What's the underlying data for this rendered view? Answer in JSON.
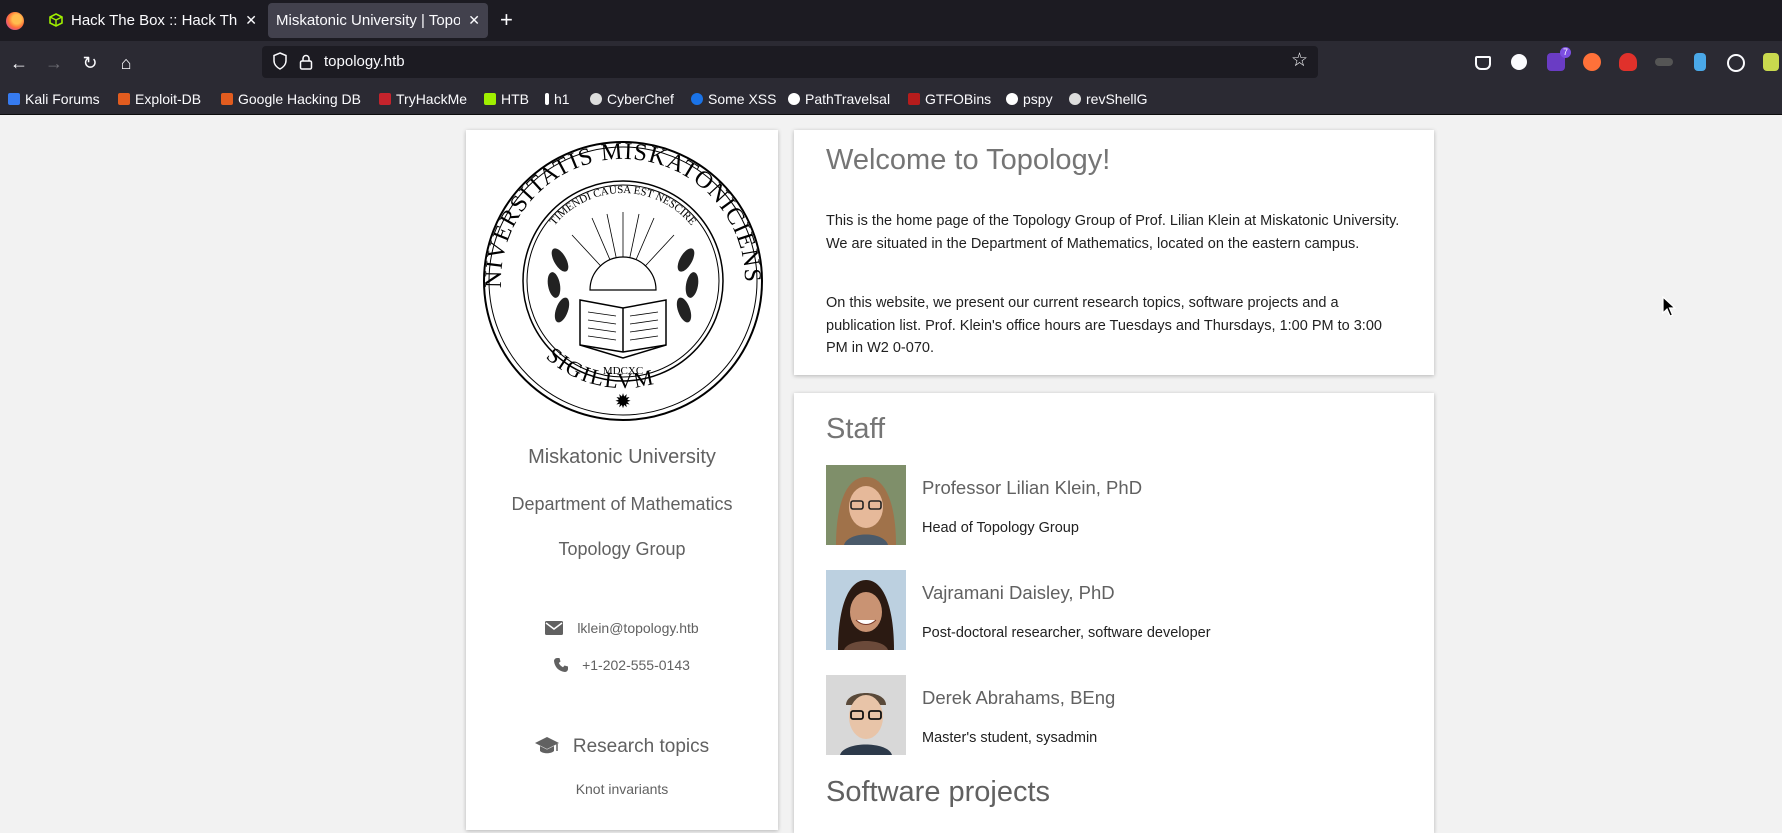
{
  "browser": {
    "tabs": [
      {
        "title": "Hack The Box :: Hack The Box",
        "active": false
      },
      {
        "title": "Miskatonic University | Topology Group",
        "active": true
      }
    ],
    "url": "topology.htb",
    "bookmarks": [
      {
        "label": "Kali Forums",
        "color": "#367bf0"
      },
      {
        "label": "Exploit-DB",
        "color": "#e25c1f"
      },
      {
        "label": "Google Hacking DB",
        "color": "#e25c1f"
      },
      {
        "label": "TryHackMe",
        "color": "#c5232c"
      },
      {
        "label": "HTB",
        "color": "#9fef00"
      },
      {
        "label": "h1",
        "color": "#ffffff"
      },
      {
        "label": "CyberChef",
        "color": "#dddddd"
      },
      {
        "label": "Some XSS",
        "color": "#1a73e8"
      },
      {
        "label": "PathTravelsal",
        "color": "#ffffff"
      },
      {
        "label": "GTFOBins",
        "color": "#b71c1c"
      },
      {
        "label": "pspy",
        "color": "#ffffff"
      },
      {
        "label": "revShellG",
        "color": "#dddddd"
      }
    ],
    "extension_badge": "7"
  },
  "sidebar": {
    "seal_text": {
      "outer_top": "UNIVERSITATIS MISKATONICIENSIS",
      "outer_bottom": "SIGILLVM",
      "motto": "TIMENDI CAUSA EST NESCIRE",
      "year": "MDCXC"
    },
    "university": "Miskatonic University",
    "department": "Department of Mathematics",
    "group": "Topology Group",
    "email": "lklein@topology.htb",
    "phone": "+1-202-555-0143",
    "research_heading": "Research topics",
    "research_items": [
      "Knot invariants"
    ]
  },
  "welcome": {
    "heading": "Welcome to Topology!",
    "p1": "This is the home page of the Topology Group of Prof. Lilian Klein at Miskatonic University. We are situated in the Department of Mathematics, located on the eastern campus.",
    "p2": "On this website, we present our current research topics, software projects and a publication list. Prof. Klein's office hours are Tuesdays and Thursdays, 1:00 PM to 3:00 PM in W2 0-070."
  },
  "staff": {
    "heading": "Staff",
    "members": [
      {
        "name": "Professor Lilian Klein, PhD",
        "role": "Head of Topology Group"
      },
      {
        "name": "Vajramani Daisley, PhD",
        "role": "Post-doctoral researcher, software developer"
      },
      {
        "name": "Derek Abrahams, BEng",
        "role": "Master's student, sysadmin"
      }
    ],
    "next_heading": "Software projects"
  },
  "colors": {
    "accent_text": "#616161",
    "body_text": "#212121",
    "chrome_dark": "#1c1b22"
  }
}
